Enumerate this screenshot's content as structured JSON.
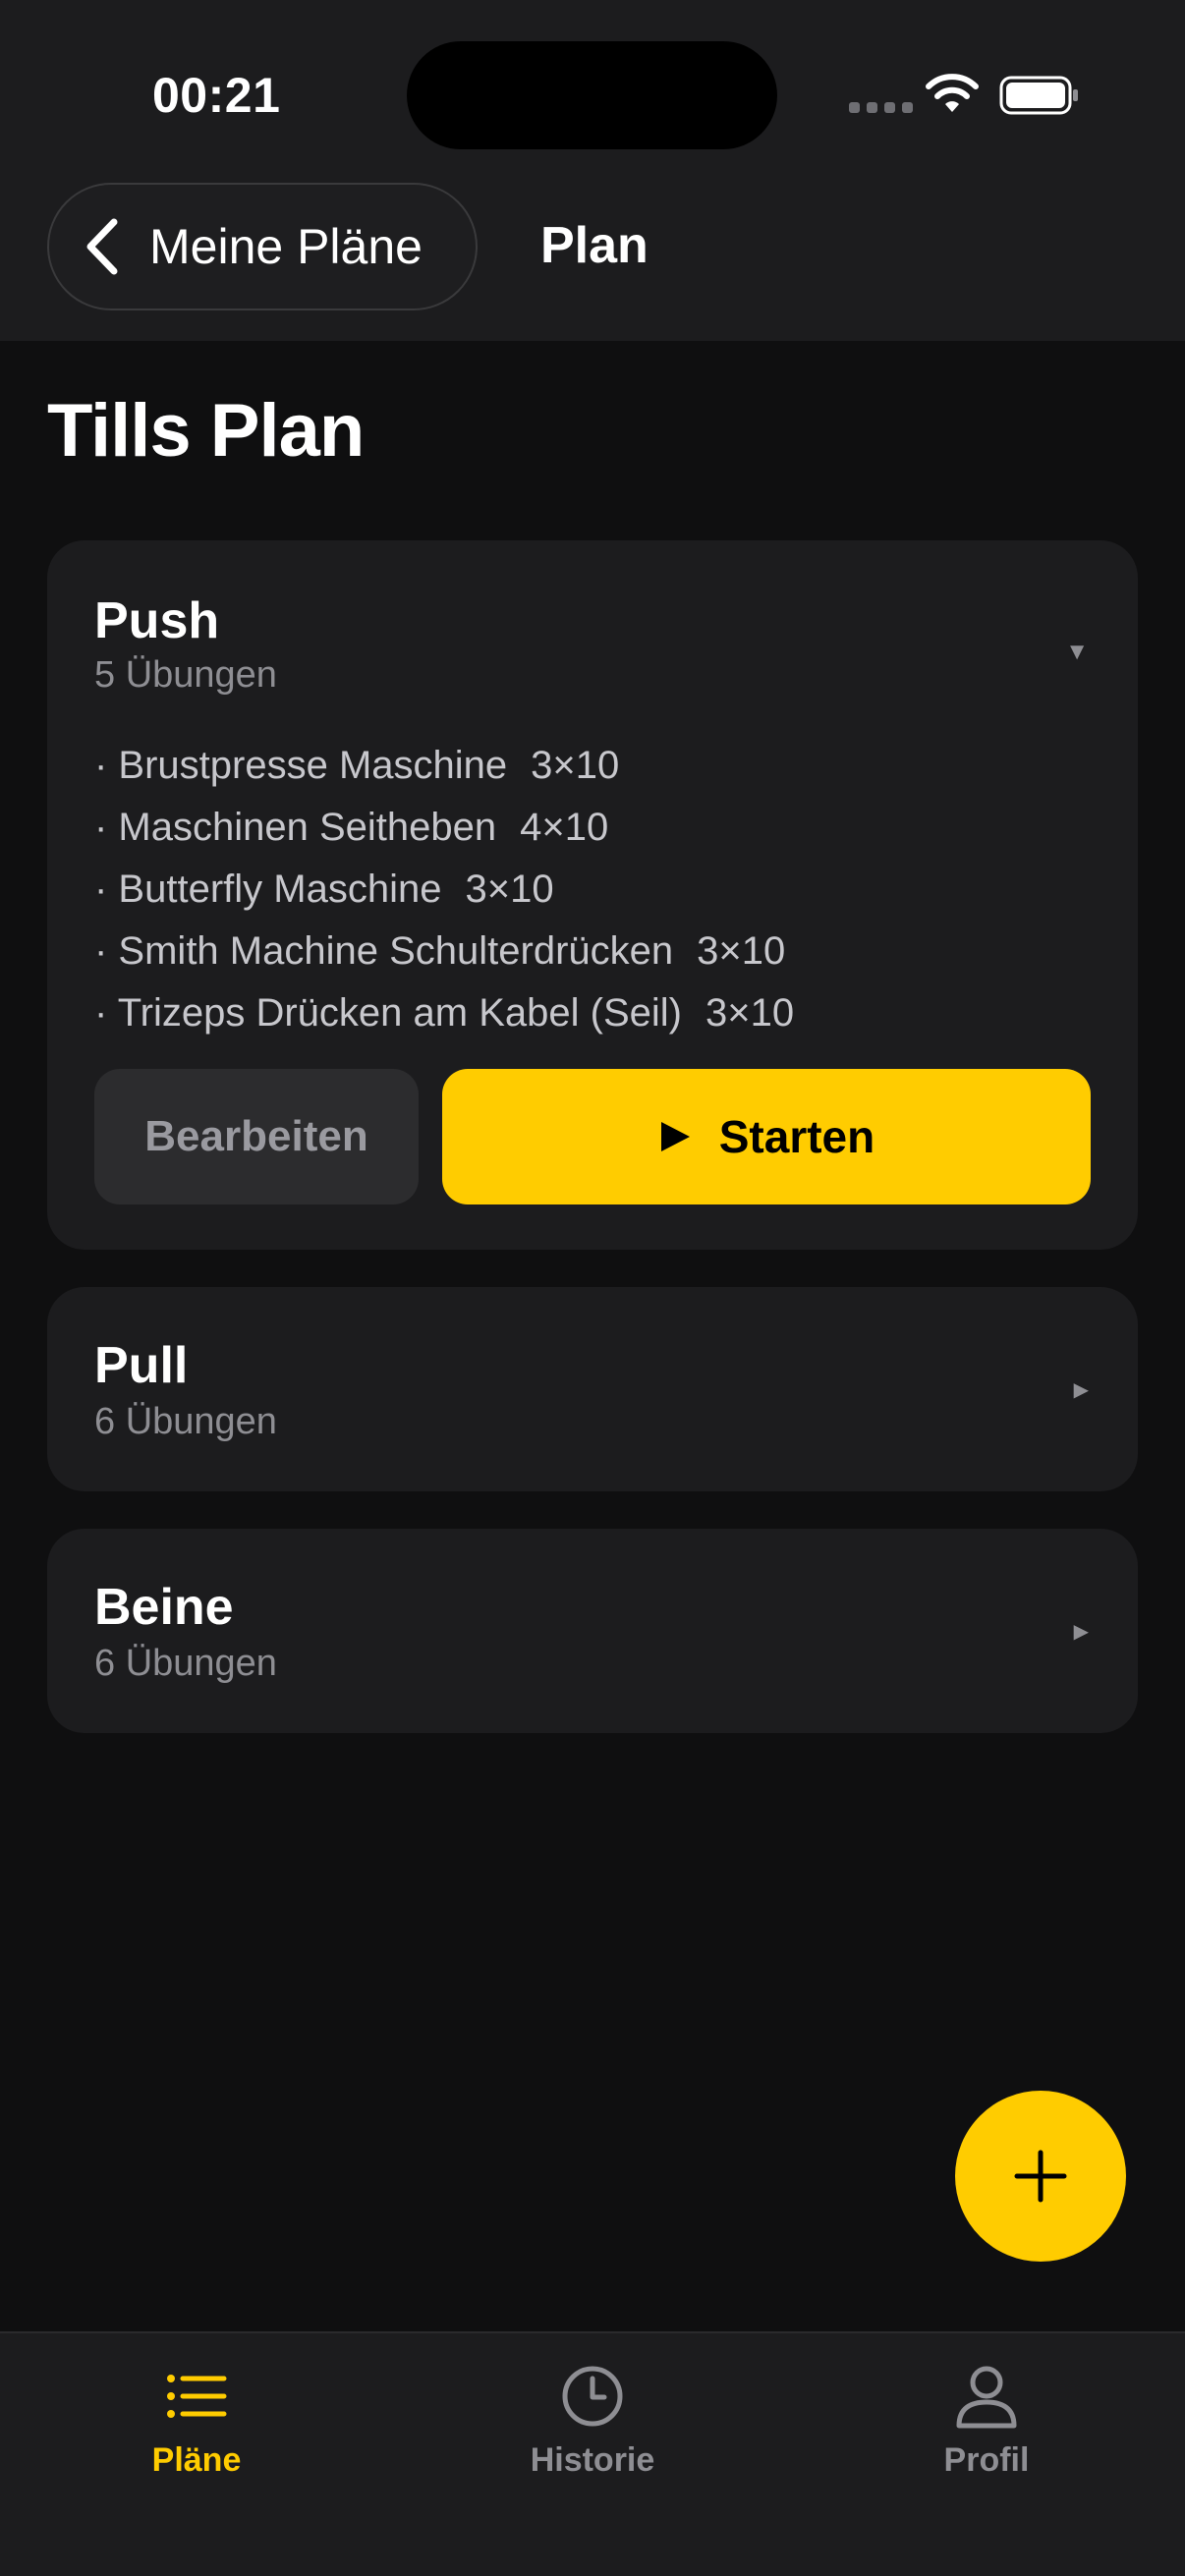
{
  "status_bar": {
    "time": "00:21"
  },
  "nav": {
    "back_label": "Meine Pläne",
    "title": "Plan"
  },
  "page_title": "Tills Plan",
  "colors": {
    "accent": "#ffcc00",
    "background": "#0f0f10",
    "card": "#1c1c1e",
    "secondary_text": "#8e8e93"
  },
  "plans": [
    {
      "name": "Push",
      "count": "5 Übungen",
      "expanded": true,
      "exercises": [
        {
          "name": "· Brustpresse Maschine",
          "sets": "3×10"
        },
        {
          "name": "· Maschinen Seitheben",
          "sets": "4×10"
        },
        {
          "name": "· Butterfly Maschine",
          "sets": "3×10"
        },
        {
          "name": "· Smith Machine Schulterdrücken",
          "sets": "3×10"
        },
        {
          "name": "· Trizeps Drücken am Kabel (Seil)",
          "sets": "3×10"
        }
      ],
      "edit_label": "Bearbeiten",
      "start_label": "Starten"
    },
    {
      "name": "Pull",
      "count": "6 Übungen",
      "expanded": false
    },
    {
      "name": "Beine",
      "count": "6 Übungen",
      "expanded": false
    }
  ],
  "fab": {
    "icon": "plus-icon"
  },
  "tabs": [
    {
      "label": "Pläne",
      "icon": "list-icon",
      "active": true
    },
    {
      "label": "Historie",
      "icon": "clock-icon",
      "active": false
    },
    {
      "label": "Profil",
      "icon": "person-icon",
      "active": false
    }
  ]
}
